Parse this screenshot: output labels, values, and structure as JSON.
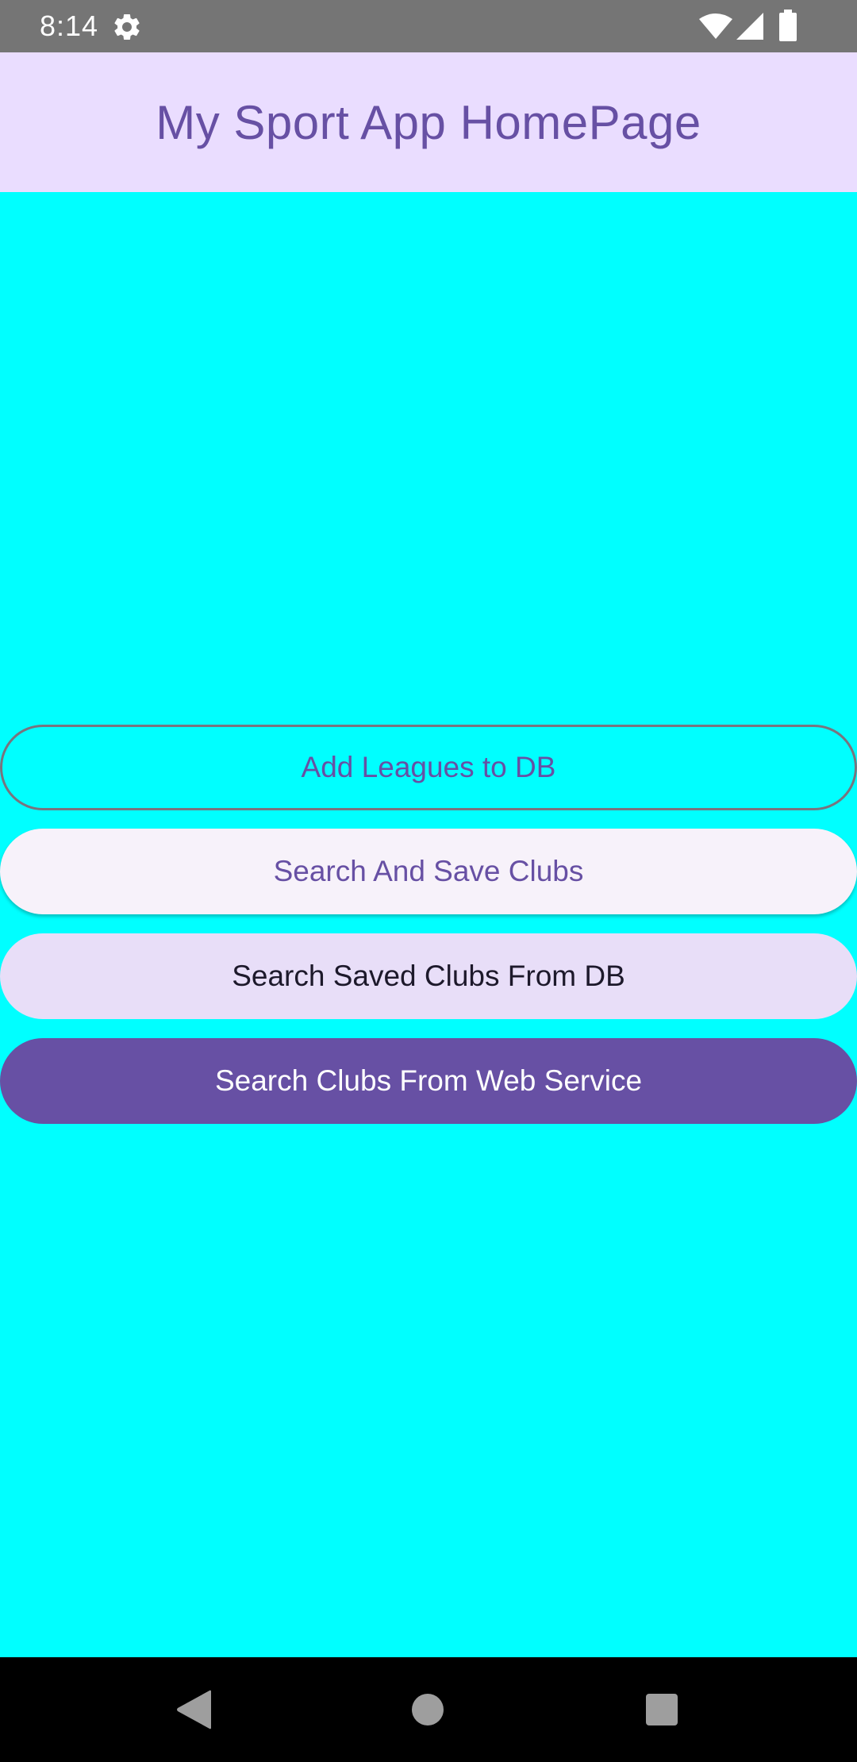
{
  "status_bar": {
    "time": "8:14",
    "icons": [
      "settings-gear-icon",
      "wifi-icon",
      "cell-signal-icon",
      "battery-icon"
    ]
  },
  "app_bar": {
    "title": "My Sport App HomePage"
  },
  "buttons": [
    {
      "label": "Add Leagues to DB",
      "style": "outlined"
    },
    {
      "label": "Search And Save Clubs",
      "style": "elevated"
    },
    {
      "label": "Search Saved Clubs From DB",
      "style": "tonal"
    },
    {
      "label": "Search Clubs From Web Service",
      "style": "filled"
    }
  ],
  "nav_bar": {
    "icons": [
      "back-icon",
      "home-icon",
      "recents-icon"
    ]
  },
  "colors": {
    "background": "#00FFFF",
    "app_bar": "#EADDFF",
    "primary": "#6750A4",
    "status_bar": "#757575",
    "nav_bar": "#000000"
  }
}
